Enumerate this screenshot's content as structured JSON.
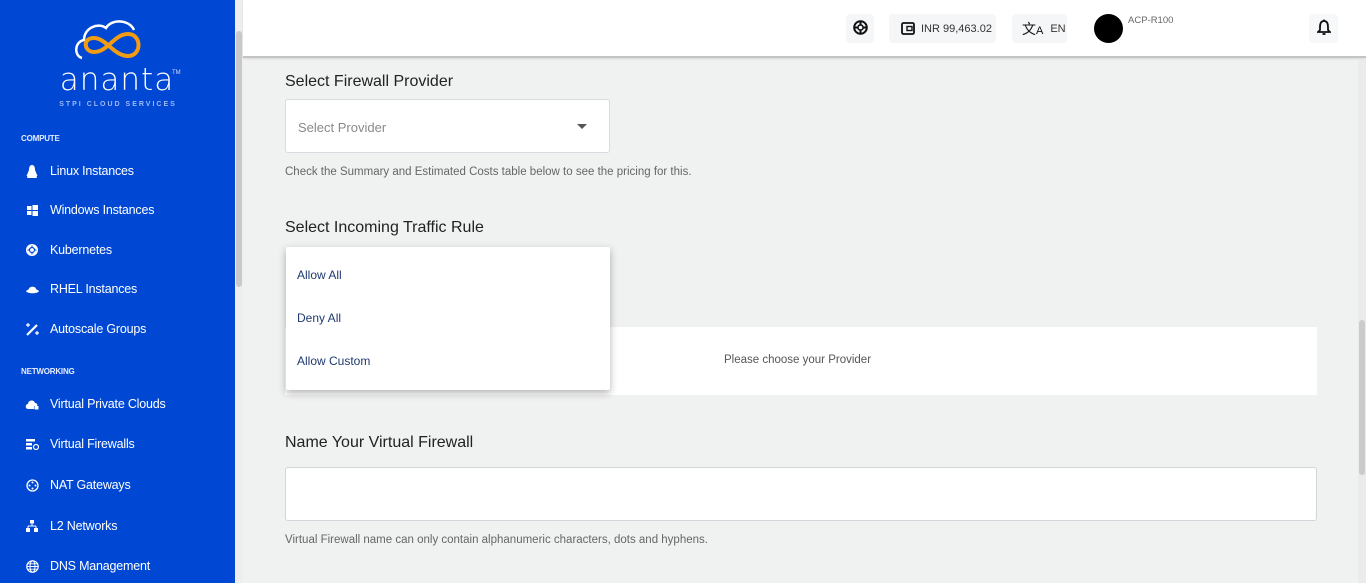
{
  "brand": {
    "name": "ananta",
    "tagline": "STPI CLOUD SERVICES",
    "tm": "TM",
    "colors": {
      "sidebar": "#0048d4",
      "logo_accent": "#f39c12"
    }
  },
  "sidebar": {
    "sections": [
      {
        "label": "COMPUTE",
        "items": [
          {
            "label": "Linux Instances",
            "icon": "linux-icon"
          },
          {
            "label": "Windows Instances",
            "icon": "windows-icon"
          },
          {
            "label": "Kubernetes",
            "icon": "kubernetes-icon"
          },
          {
            "label": "RHEL Instances",
            "icon": "redhat-icon"
          },
          {
            "label": "Autoscale Groups",
            "icon": "magic-wand-icon"
          }
        ]
      },
      {
        "label": "NETWORKING",
        "items": [
          {
            "label": "Virtual Private Clouds",
            "icon": "cloud-lock-icon"
          },
          {
            "label": "Virtual Firewalls",
            "icon": "firewall-icon"
          },
          {
            "label": "NAT Gateways",
            "icon": "nat-gateway-icon"
          },
          {
            "label": "L2 Networks",
            "icon": "network-tree-icon"
          },
          {
            "label": "DNS Management",
            "icon": "globe-icon"
          }
        ]
      }
    ]
  },
  "header": {
    "support_icon": "lifebuoy-icon",
    "wallet": {
      "icon": "wallet-icon",
      "balance": "INR 99,463.02"
    },
    "language": {
      "icon": "translate-icon",
      "code": "EN"
    },
    "account": "ACP-R100",
    "notification_icon": "bell-icon"
  },
  "form": {
    "provider": {
      "label": "Select Firewall Provider",
      "placeholder": "Select Provider",
      "hint": "Check the Summary and Estimated Costs table below to see the pricing for this."
    },
    "traffic_rule": {
      "label": "Select Incoming Traffic Rule",
      "options": [
        "Allow All",
        "Deny All",
        "Allow Custom"
      ]
    },
    "summary": {
      "message": "Please choose your Provider"
    },
    "name": {
      "label": "Name Your Virtual Firewall",
      "value": "",
      "hint": "Virtual Firewall name can only contain alphanumeric characters, dots and hyphens."
    }
  }
}
